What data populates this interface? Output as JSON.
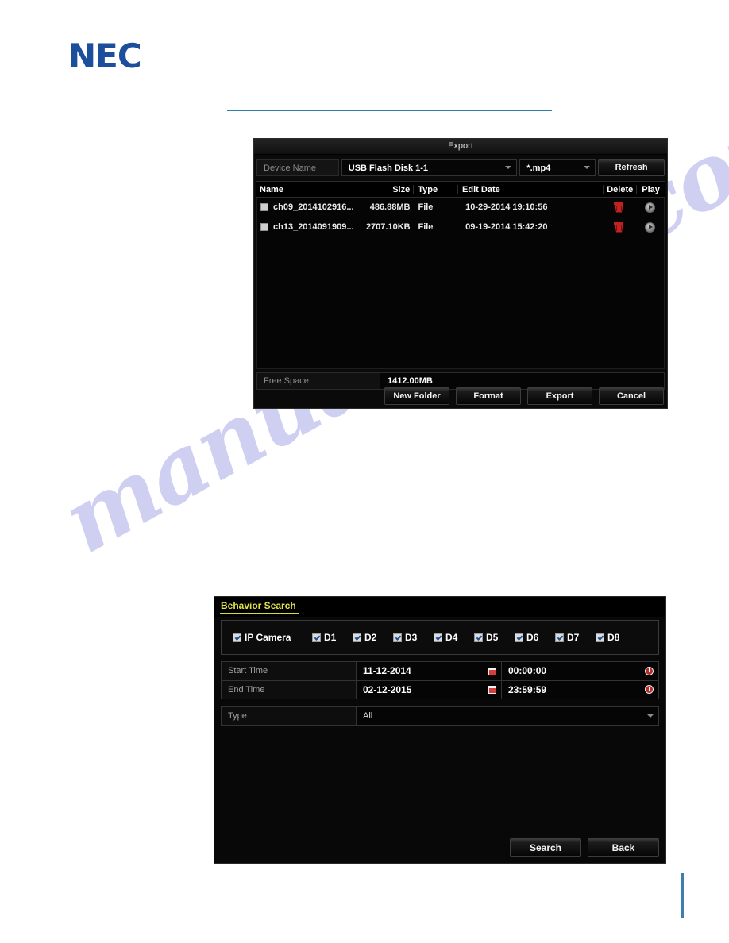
{
  "page": {
    "logo_text": "NEC"
  },
  "export_dialog": {
    "title": "Export",
    "device_label": "Device Name",
    "device_value": "USB Flash Disk 1-1",
    "format_value": "*.mp4",
    "refresh_label": "Refresh",
    "columns": {
      "name": "Name",
      "size": "Size",
      "type": "Type",
      "edit_date": "Edit Date",
      "delete": "Delete",
      "play": "Play"
    },
    "rows": [
      {
        "name": "ch09_2014102916...",
        "size": "486.88MB",
        "type": "File",
        "edit_date": "10-29-2014 19:10:56",
        "checked": false
      },
      {
        "name": "ch13_2014091909...",
        "size": "2707.10KB",
        "type": "File",
        "edit_date": "09-19-2014 15:42:20",
        "checked": false
      }
    ],
    "free_space_label": "Free Space",
    "free_space_value": "1412.00MB",
    "buttons": {
      "new_folder": "New Folder",
      "format": "Format",
      "export": "Export",
      "cancel": "Cancel"
    }
  },
  "behavior_search": {
    "tab_label": "Behavior Search",
    "ip_camera_label": "IP Camera",
    "channels": [
      "D1",
      "D2",
      "D3",
      "D4",
      "D5",
      "D6",
      "D7",
      "D8"
    ],
    "start_time_label": "Start Time",
    "start_date_value": "11-12-2014",
    "start_clock_value": "00:00:00",
    "end_time_label": "End Time",
    "end_date_value": "02-12-2015",
    "end_clock_value": "23:59:59",
    "type_label": "Type",
    "type_value": "All",
    "buttons": {
      "search": "Search",
      "back": "Back"
    }
  },
  "watermark": {
    "text": "manualshive.com"
  },
  "colors": {
    "brand_blue": "#1b4e9b",
    "rule_teal": "#2b7ca6",
    "tab_yellow": "#e2e24c",
    "delete_red": "#c42222"
  }
}
